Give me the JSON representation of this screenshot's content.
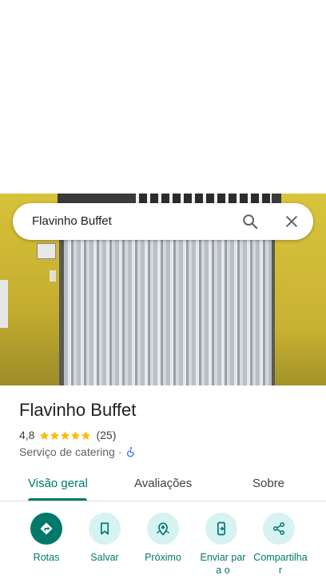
{
  "search": {
    "query": "Flavinho Buffet"
  },
  "place": {
    "name": "Flavinho Buffet",
    "rating": "4,8",
    "stars": 5,
    "review_count": "(25)",
    "category": "Serviço de catering",
    "separator": "·"
  },
  "tabs": [
    {
      "label": "Visão geral",
      "active": true
    },
    {
      "label": "Avaliações",
      "active": false
    },
    {
      "label": "Sobre",
      "active": false
    }
  ],
  "actions": [
    {
      "label": "Rotas",
      "icon": "directions-icon"
    },
    {
      "label": "Salvar",
      "icon": "bookmark-icon"
    },
    {
      "label": "Próximo",
      "icon": "nearby-icon"
    },
    {
      "label": "Enviar para o",
      "icon": "send-to-phone-icon"
    },
    {
      "label": "Compartilhar",
      "icon": "share-icon"
    }
  ],
  "colors": {
    "accent": "#00796b",
    "action_bg": "#d6f3f1",
    "star": "#fbbc04",
    "access": "#1a73e8"
  }
}
